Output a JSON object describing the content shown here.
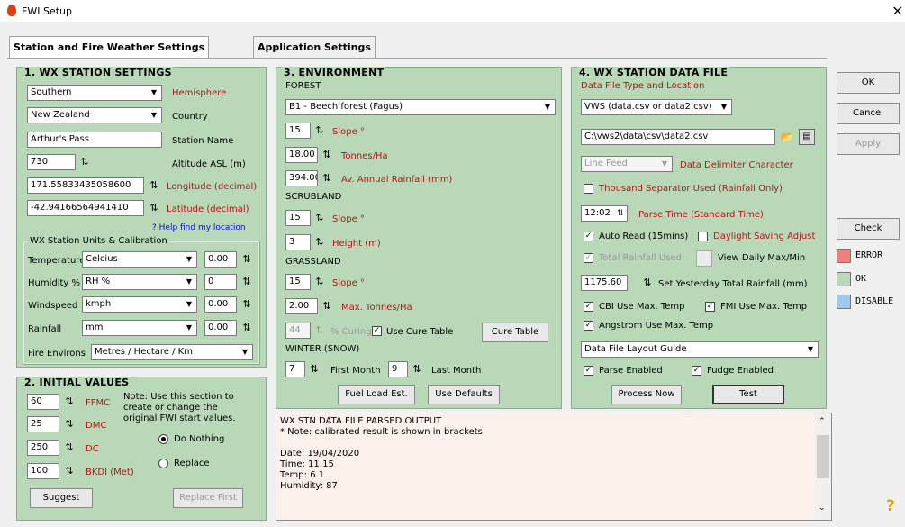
{
  "window": {
    "title": "FWI Setup",
    "close": "×"
  },
  "tabs": [
    "Station and Fire Weather Settings",
    "Application Settings"
  ],
  "wx": {
    "title": "1. WX STATION SETTINGS",
    "hemisphere": {
      "value": "Southern",
      "label": "Hemisphere"
    },
    "country": {
      "value": "New Zealand",
      "label": "Country"
    },
    "station": {
      "value": "Arthur's Pass",
      "label": "Station Name"
    },
    "altitude": {
      "value": "730",
      "label": "Altitude ASL (m)"
    },
    "longitude": {
      "value": "171.55833435058600",
      "label": "Longitude (decimal)"
    },
    "latitude": {
      "value": "-42.94166564941410",
      "label": "Latitude (decimal)"
    },
    "help_link": "? Help find my location",
    "units_title": "WX Station Units & Calibration",
    "units": [
      {
        "label": "Temperature",
        "unit": "Celcius",
        "cal": "0.00"
      },
      {
        "label": "Humidity %",
        "unit": "RH %",
        "cal": "0"
      },
      {
        "label": "Windspeed",
        "unit": "kmph",
        "cal": "0.00"
      },
      {
        "label": "Rainfall",
        "unit": "mm",
        "cal": "0.00"
      }
    ],
    "fire_environs": {
      "label": "Fire Environs",
      "value": "Metres / Hectare / Km"
    }
  },
  "initial": {
    "title": "2. INITIAL VALUES",
    "rows": [
      {
        "value": "60",
        "label": "FFMC"
      },
      {
        "value": "25",
        "label": "DMC"
      },
      {
        "value": "250",
        "label": "DC"
      },
      {
        "value": "100",
        "label": "BKDI (Met)"
      }
    ],
    "note": [
      "Note: Use this section to",
      "create or change the",
      "original FWI start values."
    ],
    "radio_nothing": "Do Nothing",
    "radio_replace": "Replace",
    "suggest": "Suggest",
    "replace_first": "Replace First"
  },
  "env": {
    "title": "3. ENVIRONMENT",
    "forest_label": "FOREST",
    "forest_type": "B1 - Beech forest (Fagus)",
    "forest_slope": {
      "value": "15",
      "label": "Slope °"
    },
    "forest_tonnes": {
      "value": "18.00",
      "label": "Tonnes/Ha"
    },
    "forest_rain": {
      "value": "394.00",
      "label": "Av. Annual Rainfall (mm)"
    },
    "scrub_label": "SCRUBLAND",
    "scrub_slope": {
      "value": "15",
      "label": "Slope °"
    },
    "scrub_height": {
      "value": "3",
      "label": "Height (m)"
    },
    "grass_label": "GRASSLAND",
    "grass_slope": {
      "value": "15",
      "label": "Slope °"
    },
    "grass_tonnes": {
      "value": "2.00",
      "label": "Max. Tonnes/Ha"
    },
    "curing": {
      "value": "44",
      "label": "% Curing"
    },
    "use_cure_table": "Use Cure Table",
    "cure_table_btn": "Cure Table",
    "winter_label": "WINTER (SNOW)",
    "first_month": {
      "value": "7",
      "label": "First Month"
    },
    "last_month": {
      "value": "9",
      "label": "Last Month"
    },
    "fuel_load_btn": "Fuel Load Est.",
    "defaults_btn": "Use Defaults"
  },
  "datafile": {
    "title": "4. WX STATION DATA FILE",
    "type_label": "Data File Type and Location",
    "type_value": "VWS (data.csv or data2.csv)",
    "path": "C:\\vws2\\data\\csv\\data2.csv",
    "delimiter": {
      "value": "Line Feed",
      "label": "Data Delimiter Character"
    },
    "thousand_sep": "Thousand Separator Used (Rainfall Only)",
    "parse_time": {
      "value": "12:02",
      "label": "Parse Time (Standard Time)"
    },
    "auto_read": "Auto Read (15mins)",
    "daylight": "Daylight Saving Adjust",
    "total_rain": "Total Rainfall Used",
    "view_daily": "View Daily Max/Min",
    "yesterday_rain": {
      "value": "1175.60",
      "label": "Set Yesterday Total Rainfall (mm)"
    },
    "cbi_max": "CBI Use Max. Temp",
    "fmi_max": "FMI Use Max. Temp",
    "angstrom_max": "Angstrom Use Max. Temp",
    "layout_guide": "Data File Layout Guide",
    "parse_enabled": "Parse Enabled",
    "fudge_enabled": "Fudge Enabled",
    "process_btn": "Process Now",
    "test_btn": "Test"
  },
  "output": {
    "lines": [
      "WX STN DATA FILE PARSED OUTPUT",
      "* Note: calibrated result is shown in brackets",
      "",
      "Date: 19/04/2020",
      "Time: 11:15",
      "Temp: 6.1",
      "Humidity: 87"
    ]
  },
  "right": {
    "ok": "OK",
    "cancel": "Cancel",
    "apply": "Apply",
    "check": "Check",
    "legend": [
      {
        "label": "ERROR",
        "color": "#f08080"
      },
      {
        "label": "OK",
        "color": "#b8d8b8"
      },
      {
        "label": "DISABLE",
        "color": "#9cc8f0"
      }
    ]
  }
}
